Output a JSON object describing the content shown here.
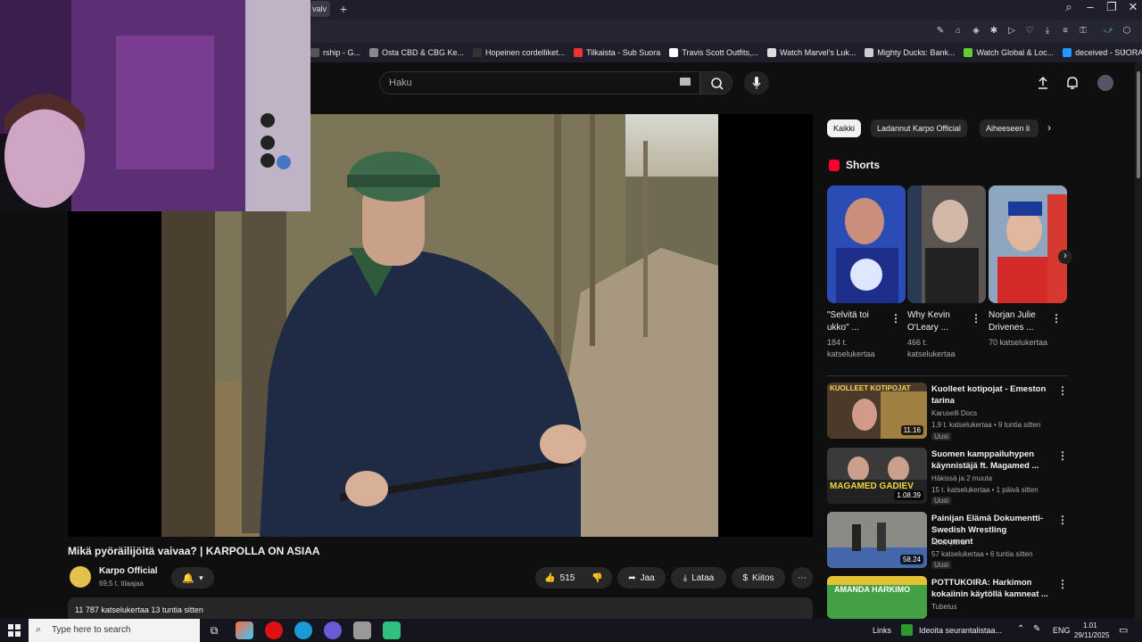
{
  "browser": {
    "tab_fragment": "valv",
    "bookmarks": [
      {
        "label": "rship - G...",
        "color": "#555"
      },
      {
        "label": "Osta CBD & CBG Ke...",
        "color": "#888"
      },
      {
        "label": "Hopeinen cordelliket...",
        "color": "#333"
      },
      {
        "label": "Tilkaista - Sub Suora",
        "color": "#e33"
      },
      {
        "label": "Travis Scott Outfits,...",
        "color": "#fff"
      },
      {
        "label": "Watch Marvel's Luk...",
        "color": "#ddd"
      },
      {
        "label": "Mighty Ducks: Bank...",
        "color": "#ccc"
      },
      {
        "label": "Watch Global & Loc...",
        "color": "#6c3"
      },
      {
        "label": "deceived - SUORAT...",
        "color": "#29f"
      }
    ]
  },
  "header": {
    "search_placeholder": "Haku"
  },
  "video": {
    "title": "Mikä pyöräilijöitä vaivaa? | KARPOLLA ON ASIAA",
    "channel_name": "Karpo Official",
    "subscribers": "69,5 t. tilaajaa",
    "likes": "515",
    "share_label": "Jaa",
    "download_label": "Lataa",
    "thanks_label": "Kiitos",
    "views_date": "11 787 katselukertaa  13 tuntia sitten"
  },
  "chips": [
    "Kaikki",
    "Ladannut Karpo Official",
    "Aiheeseen li"
  ],
  "shorts": {
    "heading": "Shorts",
    "items": [
      {
        "title": "\"Selvitä toi ukko\" ...",
        "views": "184 t. katselukertaa"
      },
      {
        "title": "Why Kevin O'Leary ...",
        "views": "466 t. katselukertaa"
      },
      {
        "title": "Norjan Julie Drivenes ...",
        "views": "70 katselukertaa"
      }
    ]
  },
  "recommendations": [
    {
      "title": "Kuolleet kotipojat - Emeston tarina",
      "channel": "Karuselli Docs",
      "meta": "1,9 t. katselukertaa • 9 tuntia sitten",
      "badge": "Uusi",
      "duration": "11.16",
      "thumb_text": "KUOLLEET KOTIPOJAT"
    },
    {
      "title": "Suomen kamppailuhypen käynnistäjä ft. Magamed ...",
      "channel": "Häkissä ja 2 muuta",
      "meta": "15 t. katselukertaa • 1 päivä sitten",
      "badge": "Uusi",
      "duration": "1.08.39",
      "thumb_text": "MAGAMED GADIEV"
    },
    {
      "title": "Painijan Elämä Dokumentti- Swedish Wrestling Document",
      "channel": "nikke pena",
      "meta": "57 katselukertaa • 6 tuntia sitten",
      "badge": "Uusi",
      "duration": "58.24",
      "thumb_text": ""
    },
    {
      "title": "POTTUKOIRA: Harkimon kokaiinin käytöllä kamneat ...",
      "channel": "Tubetus",
      "meta": "",
      "badge": "",
      "duration": "",
      "thumb_text": "AMANDA HARKIMO"
    }
  ],
  "taskbar": {
    "search_placeholder": "Type here to search",
    "links": "Links",
    "notification": "Ideoita seurantalistaa...",
    "lang": "ENG",
    "time": "1.01",
    "date": "29/11/2025"
  }
}
